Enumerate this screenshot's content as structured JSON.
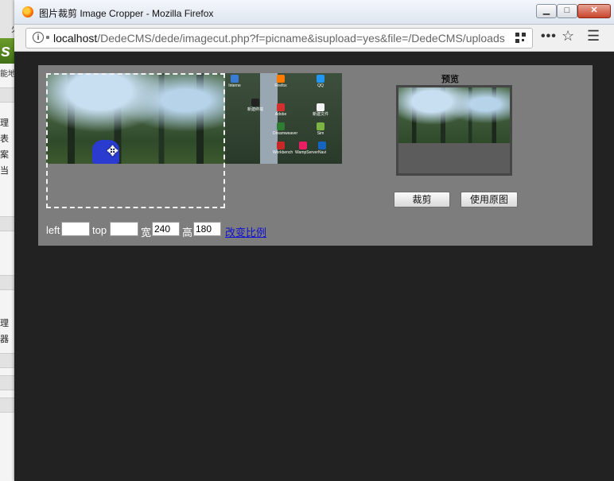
{
  "background_app": {
    "top_glyph": "火",
    "logo_text": "s",
    "sub_text": "能地",
    "items": [
      "理",
      "表",
      "案",
      "当",
      "理",
      "器"
    ]
  },
  "window": {
    "title": "图片裁剪 Image Cropper - Mozilla Firefox",
    "icon": "firefox-icon",
    "controls": {
      "minimize": "▁",
      "maximize": "□",
      "close": "✕"
    }
  },
  "navbar": {
    "url_host": "localhost",
    "url_path": "/DedeCMS/dede/imagecut.php?f=picname&isupload=yes&file=/DedeCMS/uploads",
    "more_label": "•••",
    "star_label": "☆",
    "menu_label": "☰"
  },
  "cropper": {
    "preview_label": "预览",
    "crop_button": "裁剪",
    "use_original_button": "使用原图",
    "left_label": "left",
    "left_value": "",
    "top_label": "top",
    "top_value": "",
    "width_label": "宽",
    "width_value": "240",
    "height_label": "高",
    "height_value": "180",
    "change_ratio_link": "改变比例",
    "move_cursor": "✥"
  },
  "desktop_icons": [
    {
      "label": "Interne",
      "color": "#3a7bd5"
    },
    {
      "label": "Firefox",
      "color": "#ff7a00"
    },
    {
      "label": "QQ",
      "color": "#2196f3"
    },
    {
      "label": "新建终端",
      "color": "#222"
    },
    {
      "label": "Adobe",
      "color": "#d32f2f"
    },
    {
      "label": "新建文件",
      "color": "#f4f4f4"
    },
    {
      "label": "Dreamweaver",
      "color": "#2e7d32"
    },
    {
      "label": "Sim",
      "color": "#7cb342"
    },
    {
      "label": "Workbench",
      "color": "#c62828"
    },
    {
      "label": "WampServer",
      "color": "#e91e63"
    },
    {
      "label": "Navi",
      "color": "#1565c0"
    }
  ]
}
